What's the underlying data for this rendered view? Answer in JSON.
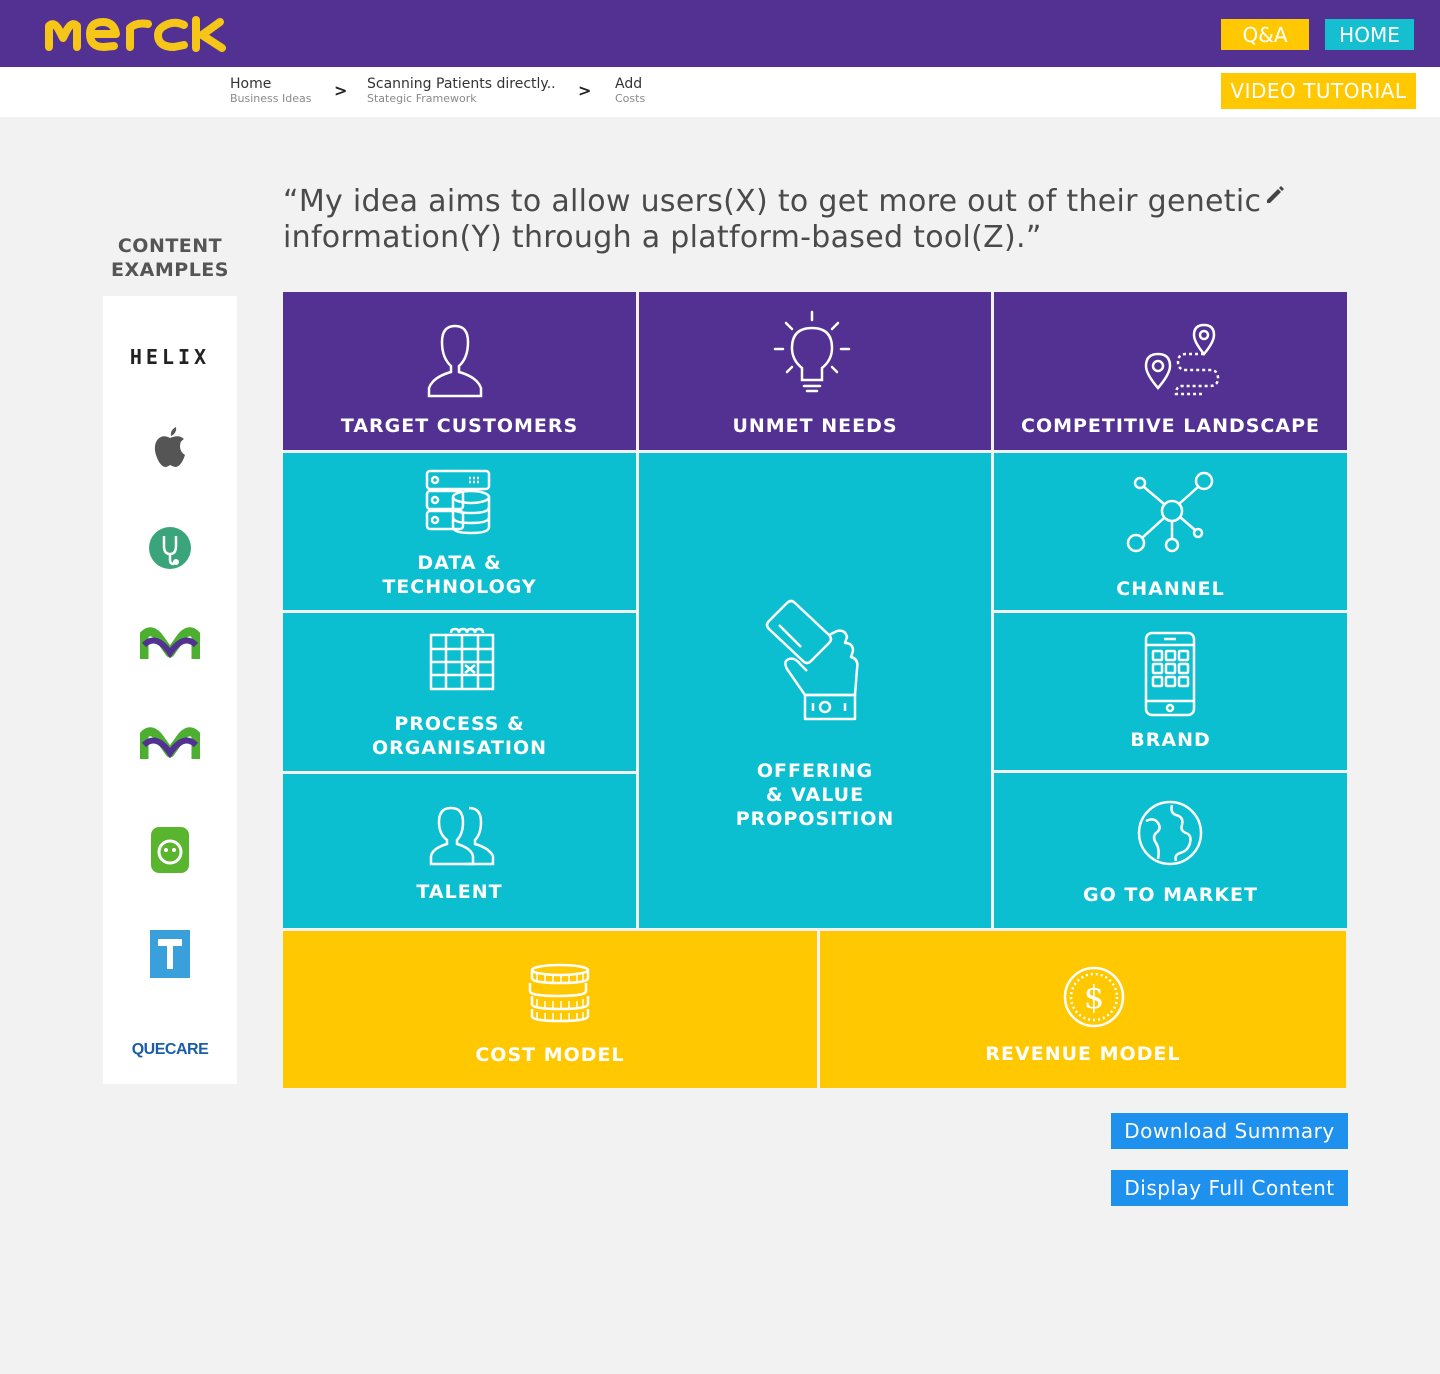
{
  "header": {
    "logo_text": "MERCK",
    "qa_label": "Q&A",
    "home_label": "HOME",
    "colors": {
      "purple": "#523193",
      "yellow": "#ffc800",
      "teal": "#16bfd0"
    }
  },
  "breadcrumb": [
    {
      "label": "Home",
      "sub": "Business Ideas"
    },
    {
      "label": "Scanning Patients directly..",
      "sub": "Stategic Framework"
    },
    {
      "label": "Add",
      "sub": "Costs"
    }
  ],
  "breadcrumb_separator": ">",
  "video_tutorial_label": "VIDEO TUTORIAL",
  "sidebar": {
    "title": "CONTENT\nEXAMPLES",
    "items": [
      {
        "name": "helix-logo",
        "text": "HELIX"
      },
      {
        "name": "apple-logo",
        "text": ""
      },
      {
        "name": "stethoscope-logo",
        "text": ""
      },
      {
        "name": "merck-logo-1",
        "text": ""
      },
      {
        "name": "merck-logo-2",
        "text": ""
      },
      {
        "name": "green-app-logo",
        "text": ""
      },
      {
        "name": "blue-t-logo",
        "text": "T"
      },
      {
        "name": "quecare-logo",
        "text": "QUECARE"
      }
    ]
  },
  "idea_statement": "“My idea aims to allow users(X) to get more out of their genetic information(Y) through a platform-based tool(Z).”",
  "canvas": {
    "target_customers": "TARGET CUSTOMERS",
    "unmet_needs": "UNMET NEEDS",
    "competitive_landscape": "COMPETITIVE LANDSCAPE",
    "data_technology": "DATA &\nTECHNOLOGY",
    "process_organisation": "PROCESS &\nORGANISATION",
    "talent": "TALENT",
    "offering": "OFFERING\n& VALUE\nPROPOSITION",
    "channel": "CHANNEL",
    "brand": "BRAND",
    "go_to_market": "GO TO MARKET",
    "cost_model": "COST MODEL",
    "revenue_model": "REVENUE MODEL",
    "currency_symbol": "$"
  },
  "actions": {
    "download_summary": "Download Summary",
    "display_full_content": "Display Full Content"
  }
}
